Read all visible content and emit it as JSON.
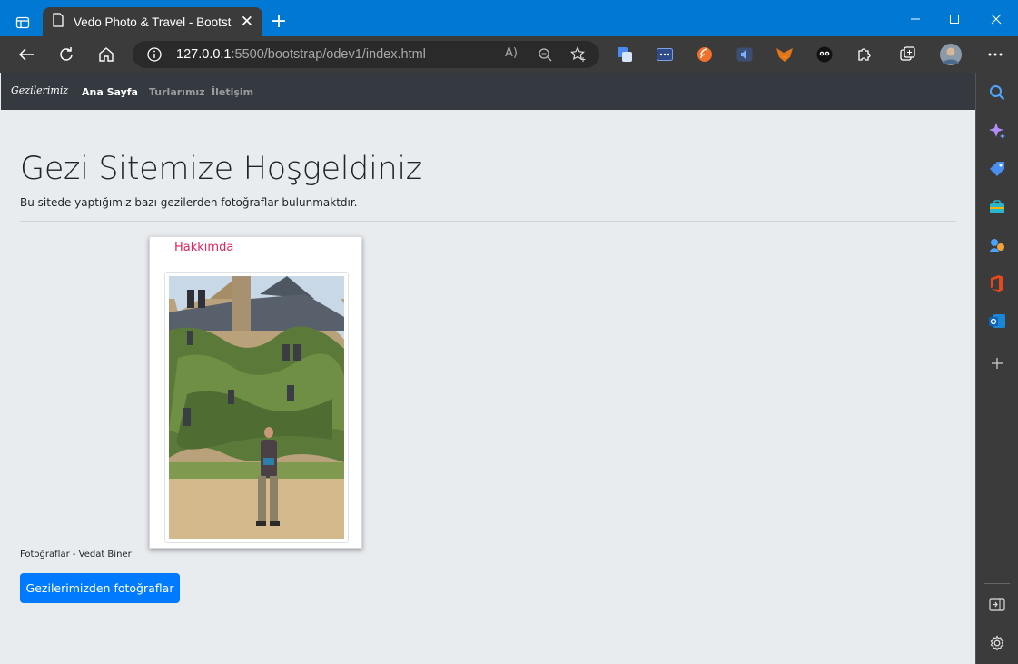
{
  "browser": {
    "tab_title": "Vedo Photo & Travel - Bootstrap",
    "url_host": "127.0.0.1",
    "url_rest": ":5500/bootstrap/odev1/index.html"
  },
  "site": {
    "brand": "Gezilerimiz",
    "nav": [
      "Ana Sayfa",
      "Turlarımız",
      "İletişim"
    ]
  },
  "hero": {
    "title": "Gezi Sitemize Hoşgeldiniz",
    "lead": "Bu sitede yaptığımız bazı gezilerden fotoğraflar bulunmaktdır."
  },
  "card": {
    "title": "Hakkımda"
  },
  "caption": "Fotoğraflar - Vedat Biner",
  "button_label": "Gezilerimizden fotoğraflar",
  "colors": {
    "titlebar": "#0078d4",
    "button": "#007bff",
    "card_title": "#e0245e"
  }
}
